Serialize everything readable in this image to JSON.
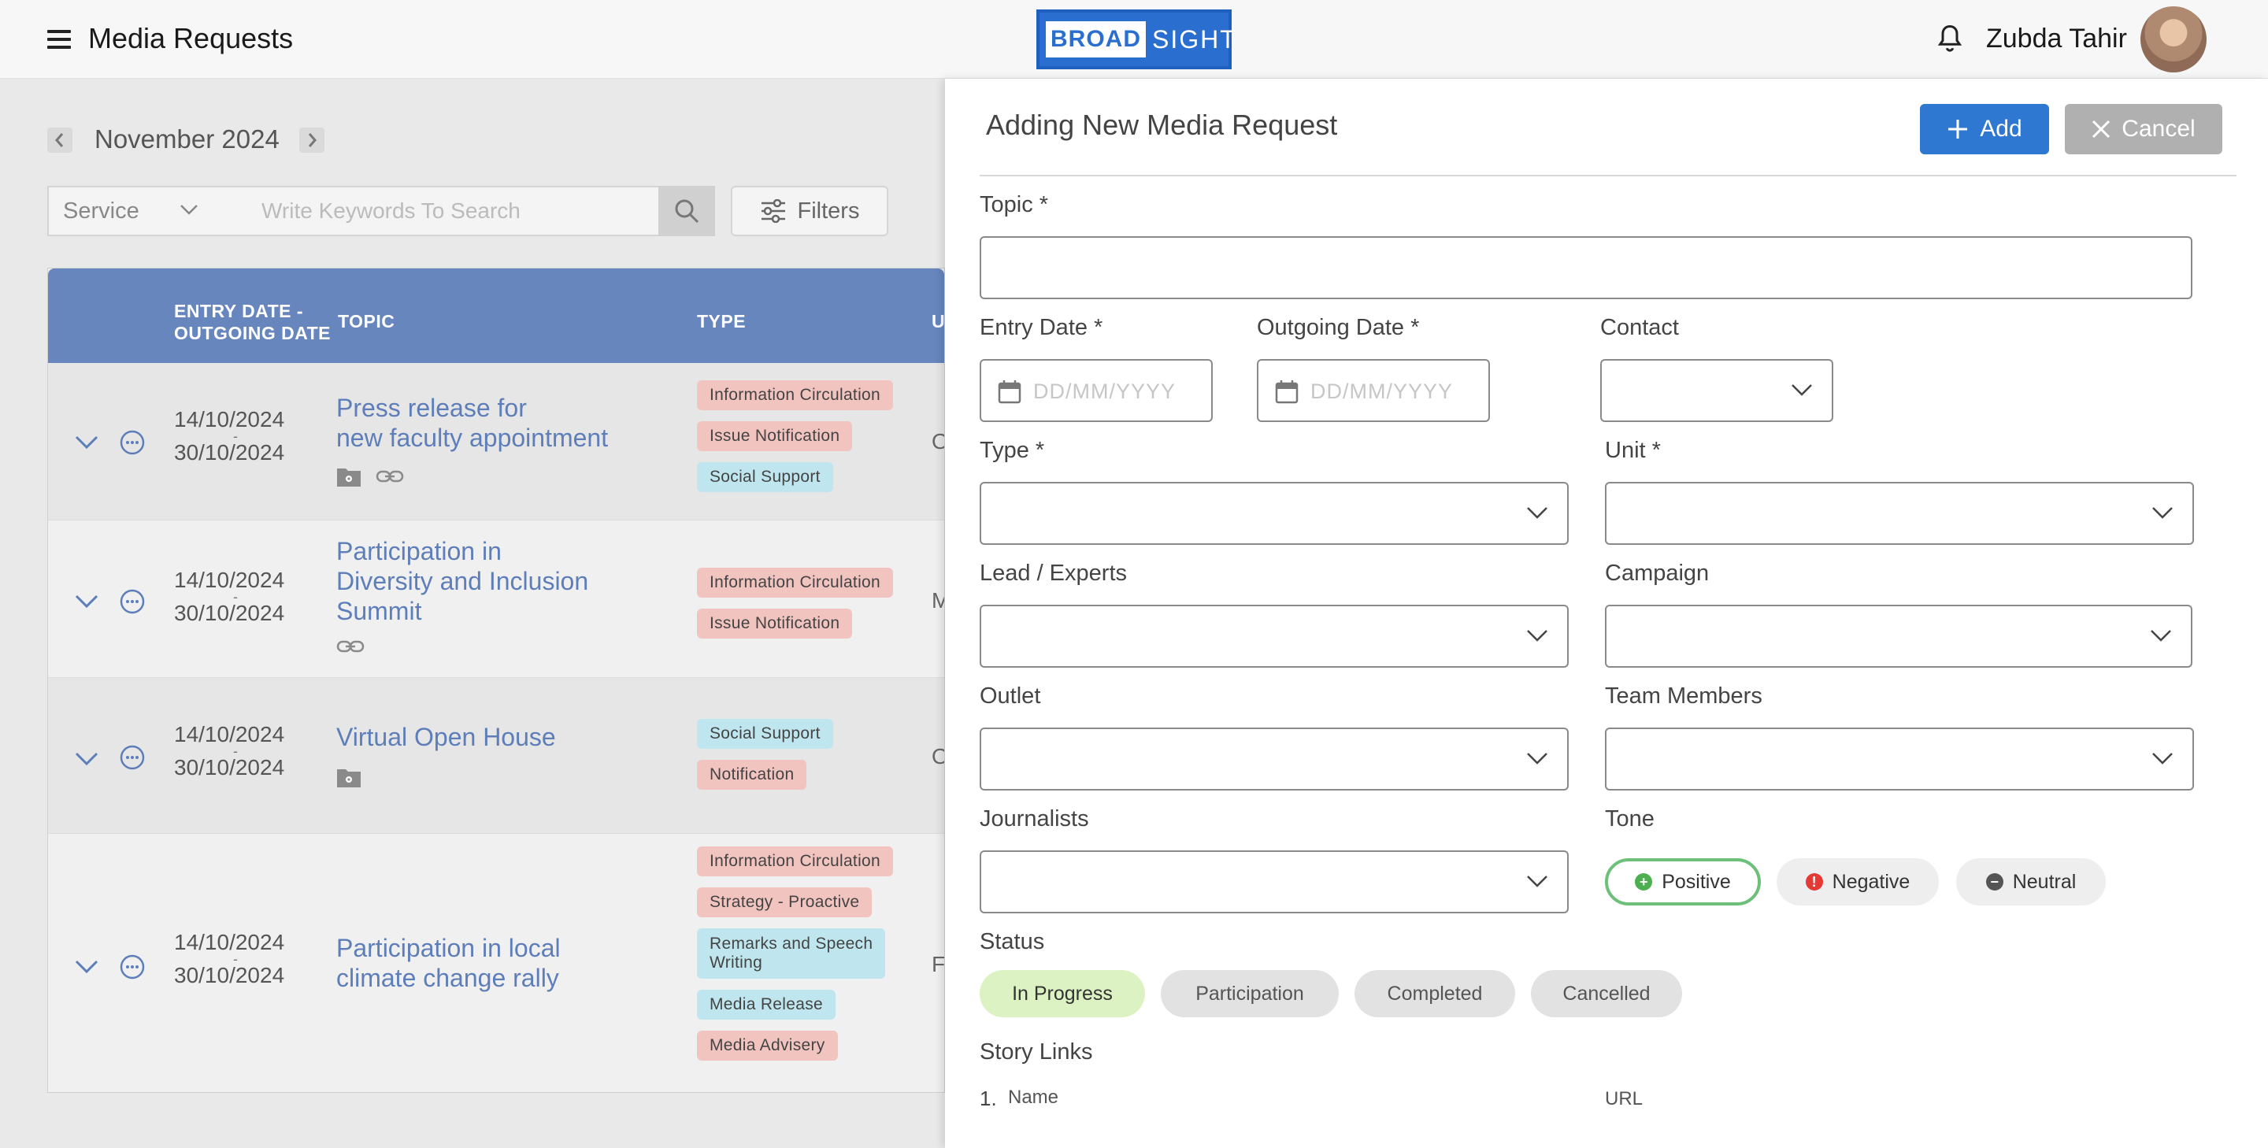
{
  "header": {
    "title": "Media Requests",
    "logo_left": "BROAD",
    "logo_right": "SIGHT",
    "user_name": "Zubda Tahir"
  },
  "list": {
    "month": "November 2024",
    "service_label": "Service",
    "search_placeholder": "Write Keywords To Search",
    "filters_label": "Filters",
    "columns": {
      "entry_date_l1": "ENTRY DATE -",
      "entry_date_l2": "OUTGOING DATE",
      "topic": "TOPIC",
      "type": "TYPE",
      "u": "U"
    },
    "rows": [
      {
        "entry": "14/10/2024",
        "dash": "-",
        "outgoing": "30/10/2024",
        "topic_l1": "Press release for",
        "topic_l2": "new faculty appointment",
        "topic_l3": "",
        "tags": [
          "Information Circulation",
          "Issue Notification",
          "Social Support"
        ],
        "u": "O"
      },
      {
        "entry": "14/10/2024",
        "dash": "-",
        "outgoing": "30/10/2024",
        "topic_l1": "Participation in",
        "topic_l2": "Diversity and Inclusion",
        "topic_l3": "Summit",
        "tags": [
          "Information Circulation",
          "Issue Notification"
        ],
        "u": "M"
      },
      {
        "entry": "14/10/2024",
        "dash": "-",
        "outgoing": "30/10/2024",
        "topic_l1": "Virtual Open House",
        "topic_l2": "",
        "topic_l3": "",
        "tags": [
          "Social Support",
          "Notification"
        ],
        "u": "O"
      },
      {
        "entry": "14/10/2024",
        "dash": "-",
        "outgoing": "30/10/2024",
        "topic_l1": "Participation in local",
        "topic_l2": "climate change rally",
        "topic_l3": "",
        "tags": [
          "Information Circulation",
          "Strategy - Proactive",
          "Remarks and Speech",
          "Writing",
          "Media Release",
          "Media Advisery"
        ],
        "u": "F"
      }
    ]
  },
  "panel": {
    "title": "Adding New Media Request",
    "add_label": "Add",
    "cancel_label": "Cancel",
    "topic_label": "Topic *",
    "entry_date_label": "Entry Date *",
    "outgoing_date_label": "Outgoing Date *",
    "contact_label": "Contact",
    "date_placeholder": "DD/MM/YYYY",
    "type_label": "Type *",
    "unit_label": "Unit *",
    "lead_label": "Lead / Experts",
    "campaign_label": "Campaign",
    "outlet_label": "Outlet",
    "team_label": "Team Members",
    "journalists_label": "Journalists",
    "tone_label": "Tone",
    "tone": {
      "positive": "Positive",
      "negative": "Negative",
      "neutral": "Neutral"
    },
    "status_label": "Status",
    "status": {
      "in_progress": "In Progress",
      "participation": "Participation",
      "completed": "Completed",
      "cancelled": "Cancelled"
    },
    "story_links_label": "Story Links",
    "story_index": "1.",
    "story_name": "Name",
    "story_url": "URL"
  },
  "colors": {
    "accent": "#2f78d1",
    "table_header": "#6686bd",
    "tag_red": "#f2c4c0",
    "tag_cyan": "#bfe6ee",
    "positive": "#6cc07a",
    "in_progress": "#dcf2c2"
  }
}
